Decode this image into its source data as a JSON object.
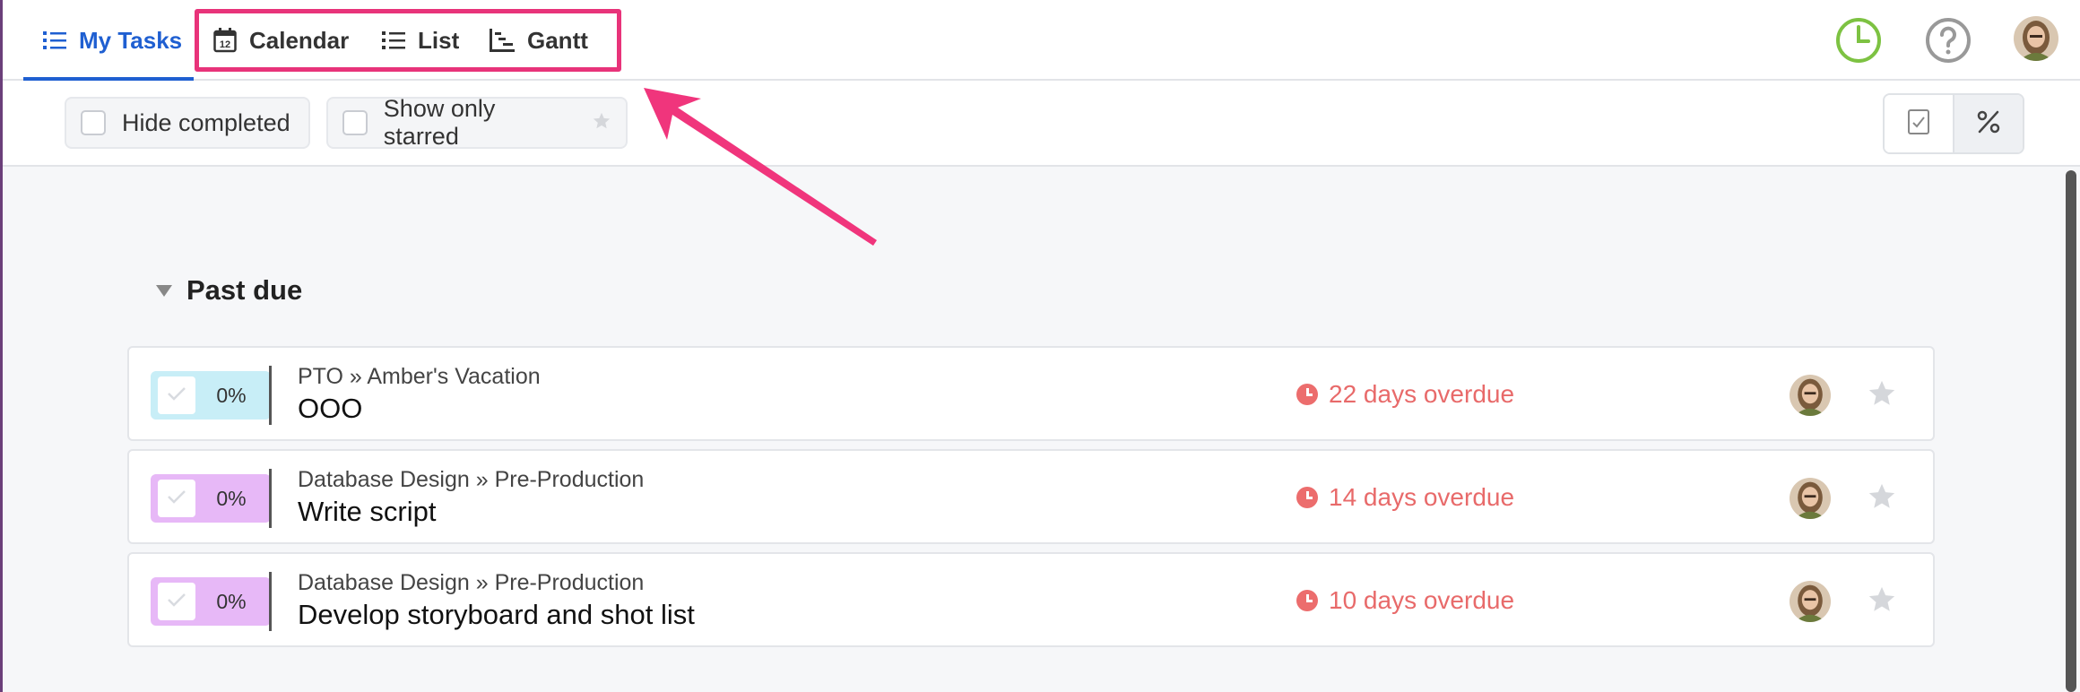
{
  "nav": {
    "tabs": [
      {
        "label": "My Tasks",
        "icon": "list-icon"
      },
      {
        "label": "Calendar",
        "icon": "calendar-icon",
        "calendar_day": "12"
      },
      {
        "label": "List",
        "icon": "list-icon"
      },
      {
        "label": "Gantt",
        "icon": "gantt-icon"
      }
    ],
    "active_tab": "My Tasks",
    "right_icons": [
      "time-tracking-clock-icon",
      "help-question-icon",
      "user-avatar"
    ]
  },
  "filters": {
    "hide_completed": {
      "label": "Hide completed",
      "checked": false
    },
    "show_only_starred": {
      "label": "Show only starred",
      "checked": false
    },
    "view_toggle": [
      "checkbox-view-icon",
      "percent-view-icon"
    ],
    "view_toggle_selected": "percent-view-icon"
  },
  "section": {
    "title": "Past due",
    "tasks": [
      {
        "breadcrumb": "PTO » Amber's Vacation",
        "title": "OOO",
        "progress": "0%",
        "progress_color": "#c8eef7",
        "due": "22 days overdue"
      },
      {
        "breadcrumb": "Database Design » Pre-Production",
        "title": "Write script",
        "progress": "0%",
        "progress_color": "#e7b8f7",
        "due": "14 days overdue"
      },
      {
        "breadcrumb": "Database Design » Pre-Production",
        "title": "Develop storyboard and shot list",
        "progress": "0%",
        "progress_color": "#e7b8f7",
        "due": "10 days overdue"
      }
    ]
  },
  "colors": {
    "accent": "#1f5fd1",
    "annotation": "#e8337a",
    "overdue": "#e86a6a",
    "clock_green": "#7dc242"
  }
}
